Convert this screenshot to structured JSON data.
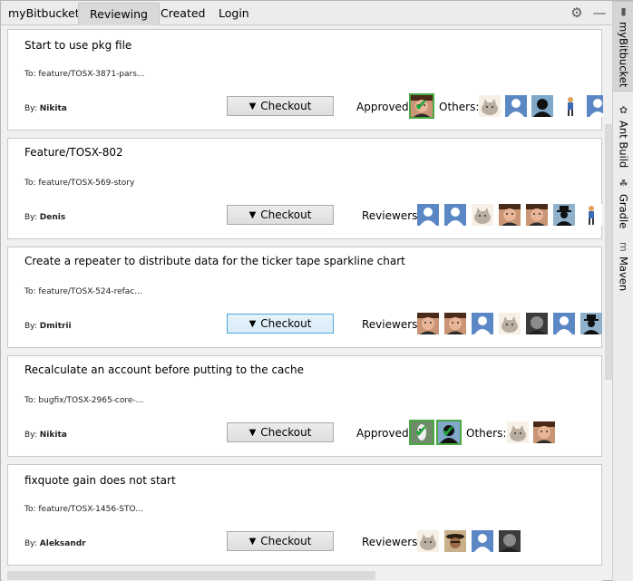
{
  "window": {
    "title": "myBitbucket:",
    "tabs": [
      {
        "label": "Reviewing",
        "active": true
      },
      {
        "label": "Created",
        "active": false
      },
      {
        "label": "Login",
        "active": false
      }
    ],
    "icons": [
      "gear-icon",
      "minimize-icon"
    ]
  },
  "sidebar": {
    "tabs": [
      {
        "label": "myBitbucket",
        "icon": "bucket-icon",
        "active": true
      },
      {
        "label": "Ant Build",
        "icon": "ant-icon",
        "active": false
      },
      {
        "label": "Gradle",
        "icon": "gradle-icon",
        "active": false
      },
      {
        "label": "Maven",
        "icon": "maven-icon",
        "active": false
      }
    ]
  },
  "checkout_label": "Checkout",
  "pull_requests": [
    {
      "title": "Start to use pkg file",
      "to": "To: feature/TOSX-3871-pars...",
      "by_label": "By:",
      "author": "Nikita",
      "checkout_focused": false,
      "approved_label": "Approved:",
      "approved": [
        "face-approved"
      ],
      "others_label": "Others:",
      "others": [
        "pusheen",
        "blank",
        "silhouette",
        "figure",
        "blank"
      ]
    },
    {
      "title": "Feature/TOSX-802",
      "to": "To: feature/TOSX-569-story",
      "by_label": "By:",
      "author": "Denis",
      "checkout_focused": false,
      "reviewers_label": "Reviewers:",
      "reviewers": [
        "blank",
        "blank",
        "pusheen",
        "face",
        "face",
        "silhouette-hat",
        "figure"
      ]
    },
    {
      "title": "Create a repeater to distribute data for the ticker tape sparkline chart",
      "to": "To: feature/TOSX-524-refac...",
      "by_label": "By:",
      "author": "Dmitrii",
      "checkout_focused": true,
      "reviewers_label": "Reviewers:",
      "reviewers": [
        "face",
        "face",
        "blank",
        "pusheen",
        "face-dark",
        "blank",
        "silhouette-hat"
      ]
    },
    {
      "title": "Recalculate an account before putting to the cache",
      "to": "To: bugfix/TOSX-2965-core-...",
      "by_label": "By:",
      "author": "Nikita",
      "checkout_focused": false,
      "approved_label": "Approved:",
      "approved": [
        "horse-approved",
        "silhouette-approved"
      ],
      "others_label": "Others:",
      "others": [
        "pusheen",
        "face"
      ]
    },
    {
      "title": "fixquote gain does not start",
      "to": "To: feature/TOSX-1456-STO...",
      "by_label": "By:",
      "author": "Aleksandr",
      "checkout_focused": false,
      "reviewers_label": "Reviewers:",
      "reviewers": [
        "pusheen",
        "pirate",
        "blank",
        "face-dark"
      ]
    }
  ]
}
